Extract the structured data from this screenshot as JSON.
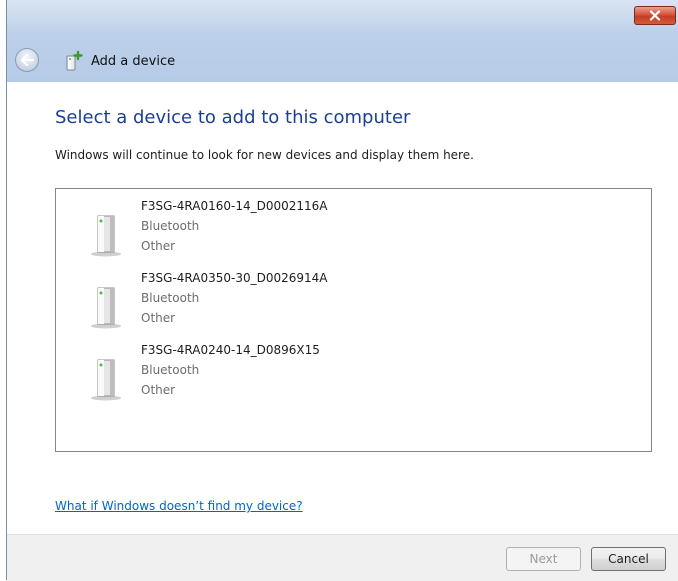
{
  "window": {
    "title": "Add a device"
  },
  "page": {
    "heading": "Select a device to add to this computer",
    "instruction": "Windows will continue to look for new devices and display them here."
  },
  "devices": [
    {
      "name": "F3SG-4RA0160-14_D0002116A",
      "type": "Bluetooth",
      "category": "Other",
      "icon": "device-tower-icon"
    },
    {
      "name": "F3SG-4RA0350-30_D0026914A",
      "type": "Bluetooth",
      "category": "Other",
      "icon": "device-tower-icon"
    },
    {
      "name": "F3SG-4RA0240-14_D0896X15",
      "type": "Bluetooth",
      "category": "Other",
      "icon": "device-tower-icon"
    }
  ],
  "help_link": "What if Windows doesn’t find my device?",
  "buttons": {
    "next": "Next",
    "cancel": "Cancel"
  },
  "colors": {
    "heading": "#1c3f94",
    "link": "#0066cc",
    "close_button": "#c53d27",
    "titlebar": "#bcd0ea"
  }
}
